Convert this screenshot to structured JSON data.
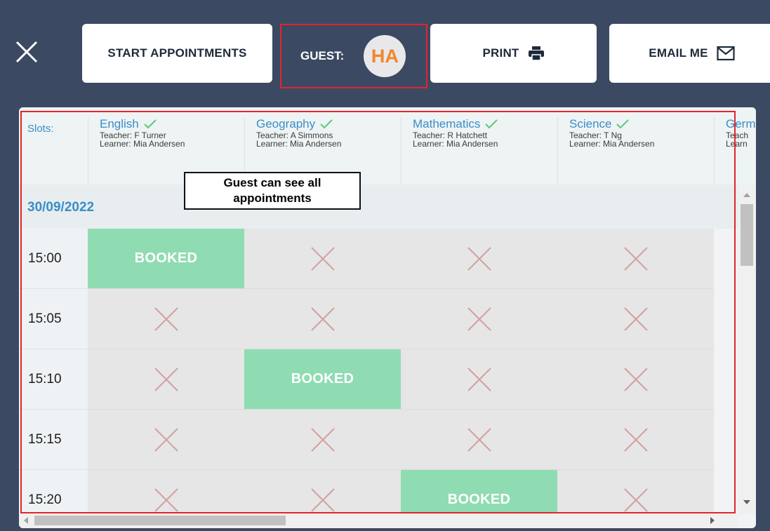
{
  "toolbar": {
    "close_icon": "close-icon",
    "start_label": "START APPOINTMENTS",
    "guest_label": "GUEST:",
    "guest_initials": "HA",
    "print_label": "PRINT",
    "print_icon": "printer-icon",
    "email_label": "EMAIL ME",
    "email_icon": "envelope-icon"
  },
  "grid": {
    "slots_label": "Slots:",
    "subjects": [
      {
        "name": "English",
        "teacher": "Teacher: F Turner",
        "learner": "Learner: Mia Andersen"
      },
      {
        "name": "Geography",
        "teacher": "Teacher: A Simmons",
        "learner": "Learner: Mia Andersen"
      },
      {
        "name": "Mathematics",
        "teacher": "Teacher: R Hatchett",
        "learner": "Learner: Mia Andersen"
      },
      {
        "name": "Science",
        "teacher": "Teacher: T Ng",
        "learner": "Learner: Mia Andersen"
      },
      {
        "name": "Germ",
        "teacher": "Teach",
        "learner": "Learn"
      }
    ],
    "date": "30/09/2022",
    "booked_label": "BOOKED",
    "rows": [
      {
        "time": "15:00",
        "slots": [
          "booked",
          "unavailable",
          "unavailable",
          "unavailable"
        ]
      },
      {
        "time": "15:05",
        "slots": [
          "unavailable",
          "unavailable",
          "unavailable",
          "unavailable"
        ]
      },
      {
        "time": "15:10",
        "slots": [
          "unavailable",
          "booked",
          "unavailable",
          "unavailable"
        ]
      },
      {
        "time": "15:15",
        "slots": [
          "unavailable",
          "unavailable",
          "unavailable",
          "unavailable"
        ]
      },
      {
        "time": "15:20",
        "slots": [
          "unavailable",
          "unavailable",
          "booked",
          "unavailable"
        ]
      }
    ]
  },
  "annotation": {
    "callout_text": "Guest can see all appointments",
    "highlight_color": "#e0262a"
  },
  "colors": {
    "background": "#3c4963",
    "accent_blue": "#3a8ec7",
    "booked": "#8fdcb3",
    "unavailable_x": "#d3a0a0",
    "avatar_text": "#f0872c"
  }
}
